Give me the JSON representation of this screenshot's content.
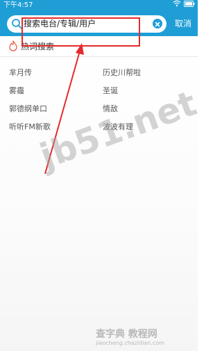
{
  "status_bar": {
    "time": "下午4:57",
    "battery_icon": "battery-icon",
    "wifi_icon": "wifi-icon"
  },
  "search": {
    "placeholder": "搜索电台/专辑/用户",
    "search_icon": "search-icon",
    "clear_icon": "clear-icon",
    "cancel_label": "取消"
  },
  "hot_search": {
    "title": "热词搜索",
    "icon": "flame-icon",
    "items": [
      "芈月传",
      "历史川帮啦",
      "雾霾",
      "圣诞",
      "郭德纲单口",
      "情敌",
      "听听FM新歌",
      "波波有理"
    ]
  },
  "watermarks": {
    "site": "jb51.net",
    "corner_main": "查字典 教程网",
    "corner_sub": "jiaocheng.chazidian.com"
  },
  "colors": {
    "header_bg": "#1f9ed6",
    "annotation": "#e52a2a"
  }
}
